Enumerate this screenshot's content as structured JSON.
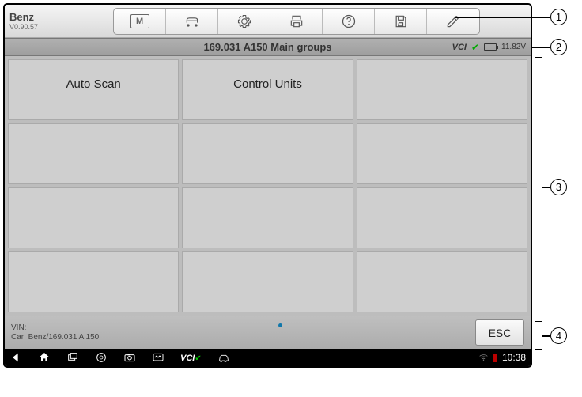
{
  "brand": {
    "name": "Benz",
    "version": "V0.90.57"
  },
  "status": {
    "title": "169.031 A150 Main groups",
    "vci_label": "VCI",
    "voltage": "11.82V"
  },
  "menu": {
    "items": [
      {
        "label": "Auto Scan"
      },
      {
        "label": "Control Units"
      },
      {
        "label": ""
      },
      {
        "label": ""
      },
      {
        "label": ""
      },
      {
        "label": ""
      },
      {
        "label": ""
      },
      {
        "label": ""
      },
      {
        "label": ""
      },
      {
        "label": ""
      },
      {
        "label": ""
      },
      {
        "label": ""
      }
    ]
  },
  "footer": {
    "vin_label": "VIN:",
    "car_label": "Car: Benz/169.031 A 150",
    "esc": "ESC"
  },
  "sysbar": {
    "vci": "VCI",
    "time": "10:38"
  },
  "callouts": {
    "n1": "1",
    "n2": "2",
    "n3": "3",
    "n4": "4"
  }
}
